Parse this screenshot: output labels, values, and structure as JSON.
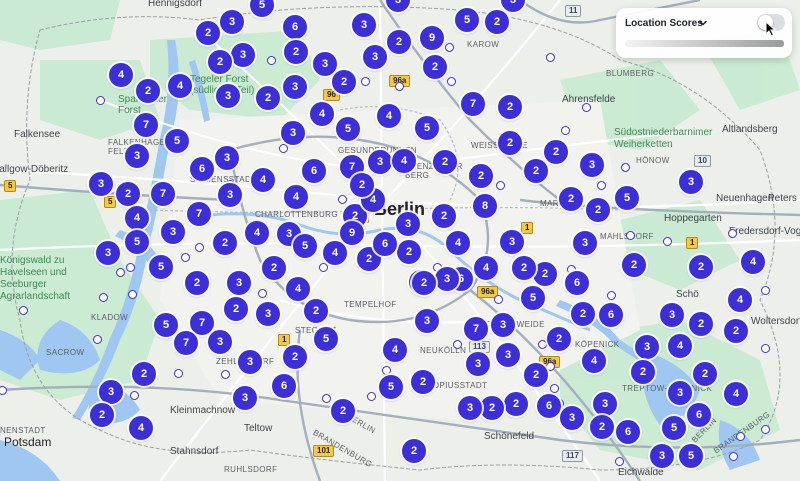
{
  "panel": {
    "title": "Location Scores",
    "dropdown_icon": "chevron-down-icon",
    "toggle_on": false
  },
  "city_label": "Berlin",
  "place_labels": [
    {
      "id": "hennigsdorf",
      "text": "Hennigsdorf",
      "style": "town"
    },
    {
      "id": "karow",
      "text": "KAROW",
      "style": "district"
    },
    {
      "id": "tegeler-forst",
      "text": "Tegeler Forst (südlicher Teil)",
      "style": "green"
    },
    {
      "id": "spandauer-forst",
      "text": "Spandauer Forst",
      "style": "green"
    },
    {
      "id": "falkensee",
      "text": "Falkensee",
      "style": "town"
    },
    {
      "id": "dallgow",
      "text": "Dallgow-Döberitz",
      "style": "town"
    },
    {
      "id": "falkenhagener",
      "text": "FALKENHAGENER FELD",
      "style": "district"
    },
    {
      "id": "siemensstadt",
      "text": "SIEMENSSTADT",
      "style": "district"
    },
    {
      "id": "charlottenburg",
      "text": "CHARLOTTENBURG",
      "style": "district"
    },
    {
      "id": "gesundbrunnen",
      "text": "GESUNDBRUNNEN",
      "style": "district"
    },
    {
      "id": "weissensee",
      "text": "WEISSENSEE",
      "style": "district"
    },
    {
      "id": "prenzlauer",
      "text": "PRENZLAUER BERG",
      "style": "district"
    },
    {
      "id": "blumberg",
      "text": "BLUMBERG",
      "style": "district"
    },
    {
      "id": "ahrensfelde",
      "text": "Ahrensfelde",
      "style": "town"
    },
    {
      "id": "suedost",
      "text": "Südostniederbarnimer Weiherketten",
      "style": "green"
    },
    {
      "id": "altlandsberg",
      "text": "Altlandsberg",
      "style": "town"
    },
    {
      "id": "hoenow",
      "text": "HÖNOW",
      "style": "district"
    },
    {
      "id": "neuenhagen",
      "text": "Neuenhagen",
      "style": "town"
    },
    {
      "id": "peters",
      "text": "Peters",
      "style": "town"
    },
    {
      "id": "hoppegarten",
      "text": "Hoppegarten",
      "style": "town"
    },
    {
      "id": "fredersdorf",
      "text": "Fredersdorf-Vogel",
      "style": "town"
    },
    {
      "id": "mahlsdorf",
      "text": "MAHLSDORF",
      "style": "district"
    },
    {
      "id": "marzahn",
      "text": "MARZAHN",
      "style": "district"
    },
    {
      "id": "koenigswald",
      "text": "Königswald zu Havelseen und Seeburger Agrarlandschaft",
      "style": "green"
    },
    {
      "id": "kladow",
      "text": "KLADOW",
      "style": "district"
    },
    {
      "id": "tempelhof",
      "text": "TEMPELHOF",
      "style": "district"
    },
    {
      "id": "schoeneweide",
      "text": "SCHÖNEWEIDE",
      "style": "district"
    },
    {
      "id": "koepenick",
      "text": "KÖPENICK",
      "style": "district"
    },
    {
      "id": "neukoelln",
      "text": "NEUKÖLLN",
      "style": "district"
    },
    {
      "id": "woltersdorf",
      "text": "Woltersdorf",
      "style": "town"
    },
    {
      "id": "schoe",
      "text": "Schö",
      "style": "town"
    },
    {
      "id": "sacrow",
      "text": "SACROW",
      "style": "district"
    },
    {
      "id": "zehlendorf",
      "text": "ZEHLENDORF",
      "style": "district"
    },
    {
      "id": "steglitz",
      "text": "STEGLITZ",
      "style": "district"
    },
    {
      "id": "gropiusstadt",
      "text": "GROPIUSSTADT",
      "style": "district"
    },
    {
      "id": "treptow",
      "text": "TREPTOW-KÖPENICK",
      "style": "district"
    },
    {
      "id": "rudow",
      "text": "RUDOW",
      "style": "district"
    },
    {
      "id": "potsdam-nstadt",
      "text": "NENSTADT",
      "style": "district"
    },
    {
      "id": "potsdam",
      "text": "Potsdam",
      "style": "mid"
    },
    {
      "id": "kleinmachnow",
      "text": "Kleinmachnow",
      "style": "town"
    },
    {
      "id": "teltow",
      "text": "Teltow",
      "style": "town"
    },
    {
      "id": "stahnsdorf",
      "text": "Stahnsdorf",
      "style": "town"
    },
    {
      "id": "ruhlsdorf",
      "text": "RUHLSDORF",
      "style": "district"
    },
    {
      "id": "schoenefeld",
      "text": "Schönefeld",
      "style": "town"
    },
    {
      "id": "eichwalde",
      "text": "Eichwalde",
      "style": "town"
    },
    {
      "id": "brandenburg-s",
      "text": "BRANDENBURG",
      "style": "district"
    },
    {
      "id": "brandenburg-se",
      "text": "BRANDENBURG",
      "style": "district"
    },
    {
      "id": "berlin-s",
      "text": "BERLIN",
      "style": "district"
    },
    {
      "id": "berlin-se",
      "text": "BERLIN",
      "style": "district"
    }
  ],
  "route_shields": [
    {
      "id": "r96a-n",
      "text": "96a",
      "style": "yellow"
    },
    {
      "id": "r96",
      "text": "96",
      "style": "yellow"
    },
    {
      "id": "r96-c",
      "text": "96",
      "style": "yellow"
    },
    {
      "id": "r5",
      "text": "5",
      "style": "yellow"
    },
    {
      "id": "r5b",
      "text": "5",
      "style": "yellow"
    },
    {
      "id": "r10",
      "text": "10",
      "style": "blue"
    },
    {
      "id": "r11",
      "text": "11",
      "style": "blue"
    },
    {
      "id": "r1",
      "text": "1",
      "style": "yellow"
    },
    {
      "id": "r1b",
      "text": "1",
      "style": "yellow"
    },
    {
      "id": "r1c",
      "text": "1",
      "style": "yellow"
    },
    {
      "id": "r96a",
      "text": "96a",
      "style": "yellow"
    },
    {
      "id": "r96a-b",
      "text": "96a",
      "style": "yellow"
    },
    {
      "id": "r113",
      "text": "113",
      "style": "blue"
    },
    {
      "id": "r101",
      "text": "101",
      "style": "yellow"
    },
    {
      "id": "r117",
      "text": "117",
      "style": "blue"
    }
  ],
  "cluster_values": [
    "5",
    "3",
    "6",
    "3",
    "3",
    "2",
    "3",
    "2",
    "3",
    "2",
    "3",
    "2",
    "5",
    "2",
    "3",
    "9",
    "2",
    "4",
    "2",
    "4",
    "3",
    "2",
    "3",
    "2",
    "7",
    "2",
    "7",
    "5",
    "3",
    "4",
    "3",
    "4",
    "5",
    "4",
    "5",
    "3",
    "6",
    "3",
    "7",
    "3",
    "2",
    "4",
    "5",
    "3",
    "3",
    "7",
    "2",
    "4",
    "3",
    "5",
    "4",
    "6",
    "7",
    "3",
    "4",
    "2",
    "2",
    "2",
    "2",
    "2",
    "3",
    "2",
    "2",
    "5",
    "8",
    "3",
    "2",
    "3",
    "2",
    "3",
    "4",
    "2",
    "4",
    "5",
    "2",
    "3",
    "2",
    "4",
    "3",
    "2",
    "2",
    "5",
    "7",
    "7",
    "3",
    "3",
    "2",
    "5",
    "6",
    "3",
    "2",
    "3",
    "2",
    "4",
    "2",
    "2",
    "5",
    "6",
    "4",
    "2",
    "5",
    "6",
    "2",
    "6",
    "2",
    "4",
    "3",
    "2",
    "2",
    "3",
    "4",
    "2",
    "2",
    "3",
    "6",
    "4",
    "5",
    "5",
    "3",
    "6",
    "3",
    "2",
    "3",
    "6",
    "2",
    "2",
    "3",
    "2",
    "3",
    "3",
    "7",
    "3",
    "3",
    "2",
    "3",
    "4",
    "5",
    "2",
    "2",
    "4",
    "2",
    "3",
    "2",
    "2",
    "4",
    "4",
    "2",
    "9",
    "6",
    "3",
    "2",
    "6",
    "5",
    "2",
    "4",
    "3",
    "2"
  ]
}
